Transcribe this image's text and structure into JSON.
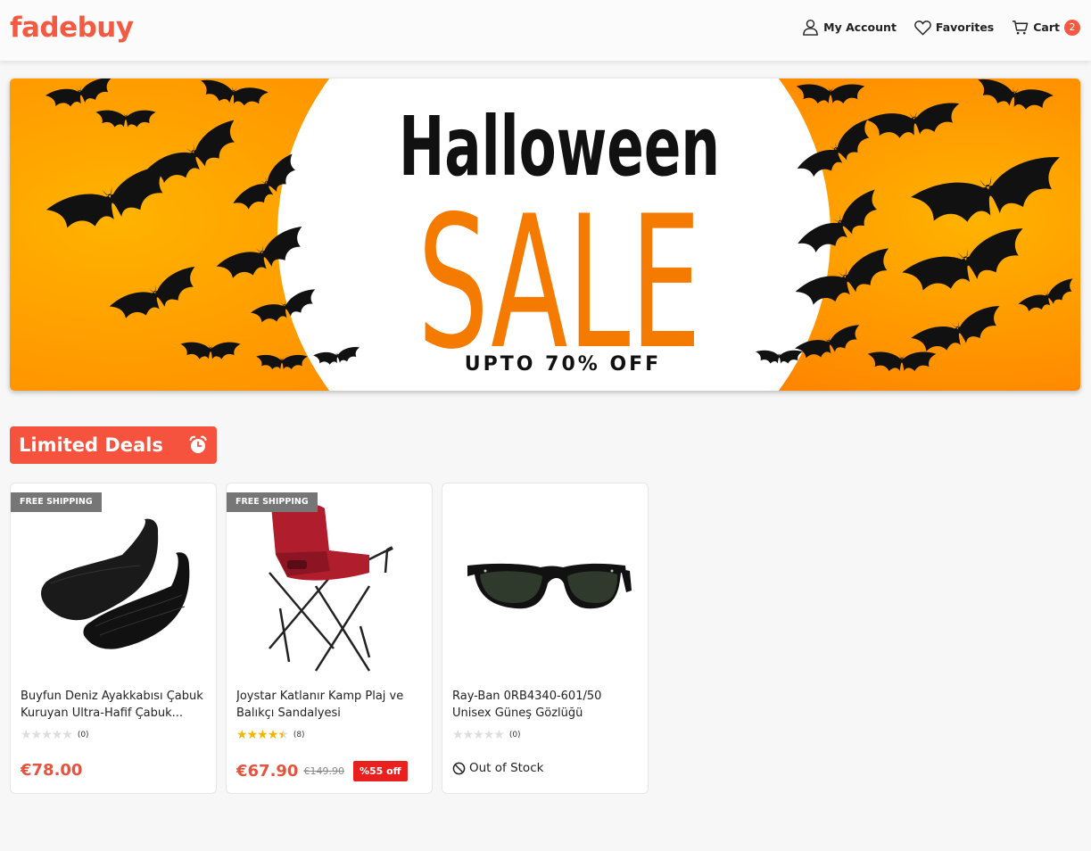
{
  "brand": {
    "name": "fadebuy",
    "color": "#f25a42"
  },
  "nav": {
    "account_label": "My Account",
    "favorites_label": "Favorites",
    "cart_label": "Cart",
    "cart_count": "2",
    "badge_color": "#f25a42"
  },
  "banner": {
    "line1": "Halloween",
    "line2": "SALE",
    "line3": "UPTO 70% OFF",
    "bg_color": "#ffa600",
    "accent_color": "#f27000"
  },
  "section": {
    "title": "Limited Deals",
    "color": "#f5533d",
    "icon": "alarm-clock-icon"
  },
  "products": [
    {
      "name": "Buyfun Deniz Ayakkabısı Çabuk Kuruyan Ultra-Hafif Çabuk...",
      "tag": "FREE SHIPPING",
      "rating": 0,
      "rating_count": "(0)",
      "price": "€78.00",
      "image": "water-shoes"
    },
    {
      "name": "Joystar Katlanır Kamp Plaj ve Balıkçı Sandalyesi",
      "tag": "FREE SHIPPING",
      "rating": 4.5,
      "rating_count": "(8)",
      "price": "€67.90",
      "old_price": "€149.90",
      "discount": "%55 off",
      "image": "camping-chair"
    },
    {
      "name": "Ray-Ban 0RB4340-601/50 Unisex Güneş Gözlüğü",
      "rating": 0,
      "rating_count": "(0)",
      "stock_label": "Out of Stock",
      "image": "sunglasses"
    }
  ],
  "colors": {
    "price": "#e8533e",
    "discount_bg": "#e8201e",
    "star_filled": "#f4b400",
    "star_empty": "#dddddd"
  }
}
